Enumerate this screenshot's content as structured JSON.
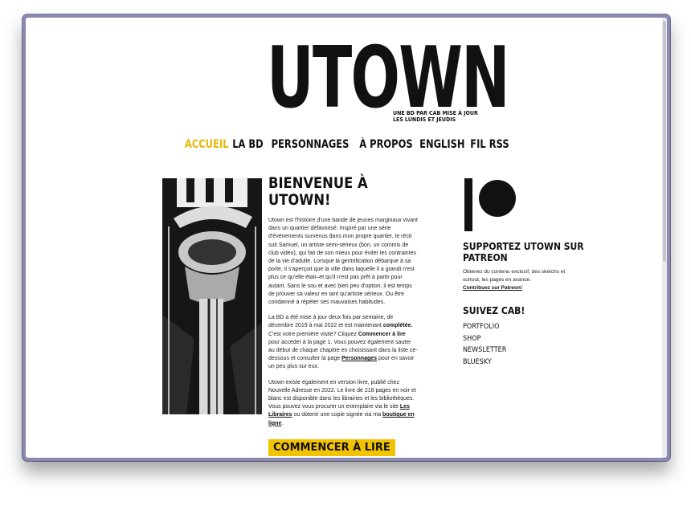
{
  "logo": {
    "wordmark": "UTOWN",
    "tagline": "UNE BD PAR CAB MISE À JOUR LES LUNDIS ET JEUDIS"
  },
  "nav": [
    {
      "label": "ACCUEIL",
      "active": true
    },
    {
      "label": "LA BD",
      "active": false
    },
    {
      "label": "PERSONNAGES",
      "active": false
    },
    {
      "label": "À PROPOS",
      "active": false
    },
    {
      "label": "ENGLISH",
      "active": false
    },
    {
      "label": "FIL RSS",
      "active": false
    }
  ],
  "main": {
    "title": "BIENVENUE À UTOWN!",
    "p1": "Utown est l'histoire d'une bande de jeunes marginaux vivant dans un quartier défavorisé. Inspiré par une série d'événements survenus dans mon propre quartier, le récit suit Samuel, un artiste semi-sérieux (bon, un commis de club vidéo), qui fait de son mieux pour éviter les contraintes de la vie d'adulte. Lorsque la gentrification débarque à sa porte, il s'aperçoit que la ville dans laquelle il a grandi n'est plus ce qu'elle était–et qu'il n'est pas prêt à partir pour autant. Sans le sou et avec bien peu d'option, il est temps de prouver sa valeur en tant qu'artiste sérieux. Ou être condamné à répéter ses mauvaises habitudes.",
    "p2_a": "La BD a été mise à jour deux fois par semaine, de décembre 2019 à mai 2022 et est maintenant ",
    "p2_b": "complétée.",
    "p2_c": " C'est votre première visite? Cliquez ",
    "p2_d": "Commencer à lire",
    "p2_e": " pour accéder à la page 1. Vous pouvez également sauter au début de chaque chapitre en choisissant dans la liste ce-dessous et consulter la page ",
    "p2_link": "Personnages",
    "p2_f": " pour en savoir un peu plus sur eux.",
    "p3_a": "Utown existe également en version livre, publié chez Nouvelle Adresse en 2022. Le livre de 216 pages en noir et blanc est disponible dans les librairies et les bibliothèques. Vous pouvez vous procurer un exemplaire via le site ",
    "p3_link1": "Les Libraires",
    "p3_b": "  ou obtenir une copie signée via ma ",
    "p3_link2": "boutique en ligne",
    "p3_c": ".",
    "start_button": "COMMENCER À LIRE"
  },
  "side": {
    "patreon_title": "SUPPORTEZ UTOWN SUR PATREON",
    "patreon_text": "Obtenez du contenu exclusif, des sketchs et surtout, les pages en avance.",
    "patreon_link": "Contribuez sur Patreon!",
    "follow_title": "SUIVEZ CAB!",
    "links": [
      "PORTFOLIO",
      "SHOP",
      "NEWSLETTER",
      "BLUESKY"
    ]
  }
}
